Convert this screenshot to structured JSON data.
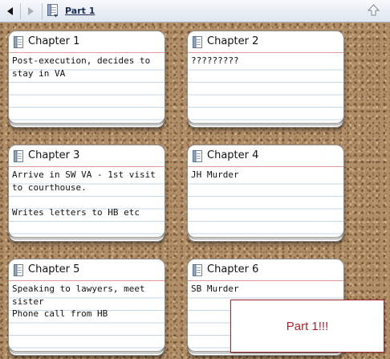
{
  "toolbar": {
    "back_icon": "back-arrow-icon",
    "forward_icon": "forward-arrow-icon",
    "doc_icon": "document-icon",
    "title": "Part 1",
    "up_icon": "up-arrow-icon"
  },
  "cards": [
    {
      "title": "Chapter 1",
      "synopsis": "Post-execution, decides to stay in VA"
    },
    {
      "title": "Chapter 2",
      "synopsis": "?????????"
    },
    {
      "title": "Chapter 3",
      "synopsis": "Arrive in SW VA - 1st visit to courthouse.\n\nWrites letters to HB etc"
    },
    {
      "title": "Chapter 4",
      "synopsis": "JH Murder"
    },
    {
      "title": "Chapter 5",
      "synopsis": "Speaking to lawyers, meet sister\nPhone call from HB"
    },
    {
      "title": "Chapter 6",
      "synopsis": "SB Murder"
    }
  ],
  "overlay": {
    "text": "Part 1!!!"
  },
  "colors": {
    "accent": "#b3242b",
    "cork": "#b08e68",
    "card_rule": "#c4d8ea",
    "card_header_rule": "#e39a9a"
  }
}
